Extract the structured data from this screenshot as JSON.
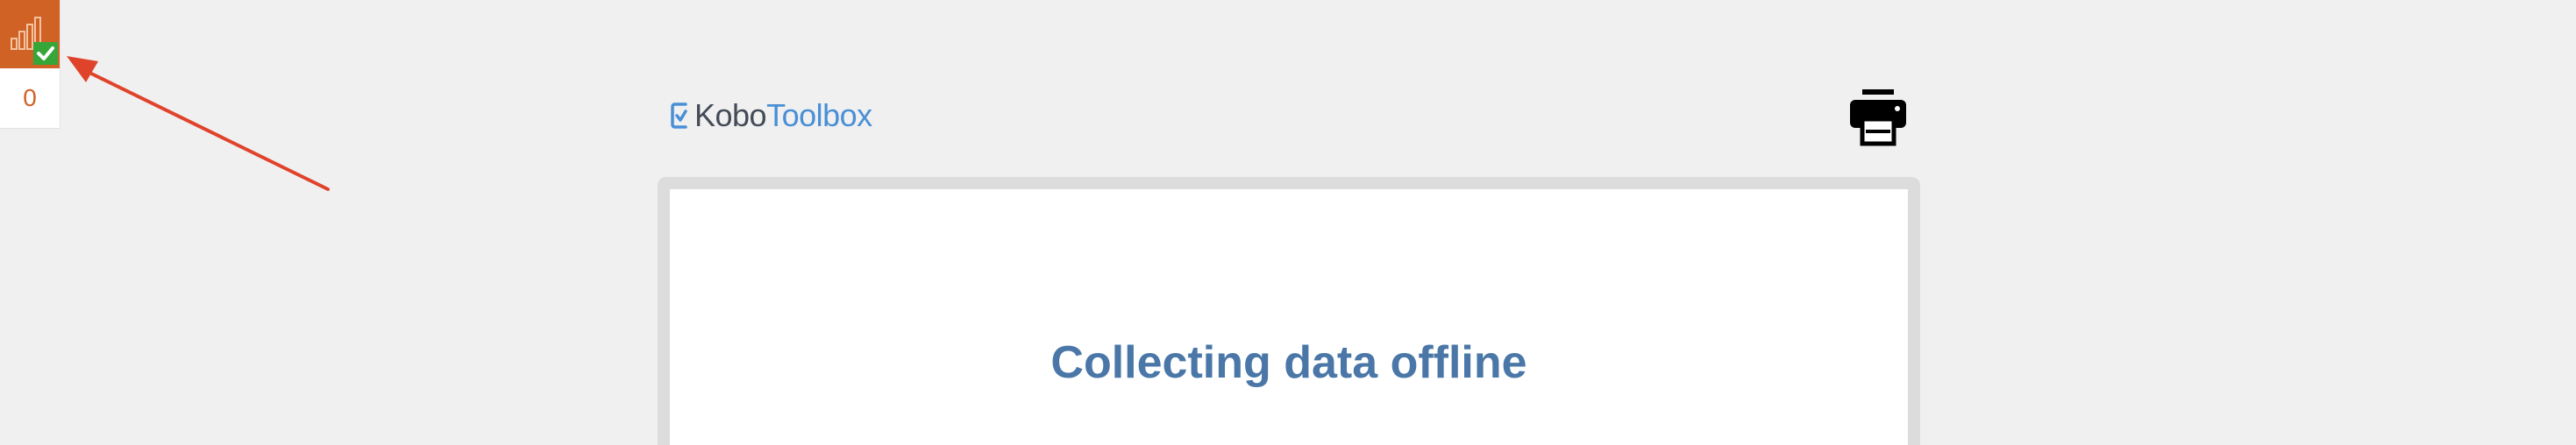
{
  "queue": {
    "count": "0",
    "icon": "signal-bars-check-icon",
    "colors": {
      "background": "#d16225",
      "check": "#36a639"
    }
  },
  "header": {
    "logo_part1": "Kobo",
    "logo_part2": "Toolbox",
    "print_icon": "printer-icon"
  },
  "form": {
    "title": "Collecting data offline"
  },
  "annotation": {
    "color": "#e0432b",
    "icon": "arrow-icon"
  }
}
